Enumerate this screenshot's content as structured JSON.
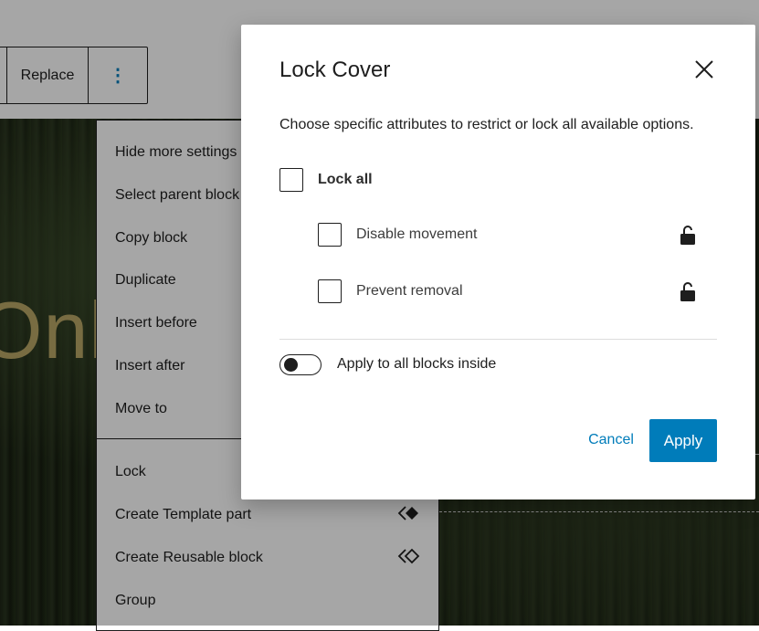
{
  "toolbar": {
    "replace_label": "Replace",
    "more_glyph": "⋮"
  },
  "cover": {
    "heading_fragment": "Onl"
  },
  "menu": {
    "items": [
      {
        "label": "Hide more settings"
      },
      {
        "label": "Select parent block"
      },
      {
        "label": "Copy block"
      },
      {
        "label": "Duplicate"
      },
      {
        "label": "Insert before"
      },
      {
        "label": "Insert after"
      },
      {
        "label": "Move to"
      },
      {
        "label": "Lock"
      },
      {
        "label": "Create Template part",
        "icon": "template-part-icon"
      },
      {
        "label": "Create Reusable block",
        "icon": "reusable-block-icon"
      },
      {
        "label": "Group"
      }
    ]
  },
  "modal": {
    "title": "Lock Cover",
    "close_icon": "close-icon",
    "description": "Choose specific attributes to restrict or lock all available options.",
    "lock_all": {
      "label": "Lock all",
      "checked": false
    },
    "options": [
      {
        "label": "Disable movement",
        "checked": false,
        "icon": "unlock-icon"
      },
      {
        "label": "Prevent removal",
        "checked": false,
        "icon": "unlock-icon"
      }
    ],
    "apply_inside": {
      "label": "Apply to all blocks inside",
      "on": false
    },
    "cancel_label": "Cancel",
    "apply_label": "Apply"
  },
  "colors": {
    "accent": "#007cba",
    "text": "#1e1e1e",
    "cover_heading": "#b9a766"
  }
}
